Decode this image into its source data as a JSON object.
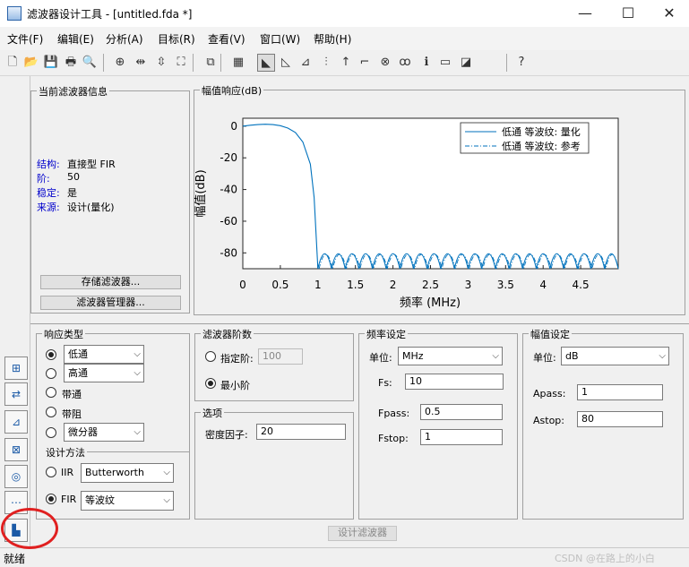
{
  "window": {
    "title": "滤波器设计工具 - [untitled.fda *]",
    "minimize": "—",
    "maximize": "☐",
    "close": "✕"
  },
  "menu": [
    "文件(F)",
    "编辑(E)",
    "分析(A)",
    "目标(R)",
    "查看(V)",
    "窗口(W)",
    "帮助(H)"
  ],
  "toolbar": {
    "icons": [
      "new-file-icon",
      "open-folder-icon",
      "save-icon",
      "print-icon",
      "print-preview-icon",
      "zoom-in-icon",
      "zoom-x-icon",
      "zoom-y-icon",
      "full-view-icon",
      "new-window-icon",
      "filter-spec-icon",
      "magnitude-response-icon",
      "phase-response-icon",
      "mag-phase-icon",
      "group-delay-icon",
      "impulse-response-icon",
      "step-response-icon",
      "pole-zero-icon",
      "coefficients-icon",
      "info-icon",
      "cost-icon",
      "noise-icon",
      "whats-this-icon"
    ],
    "glyphs": [
      "🗋",
      "📂",
      "💾",
      "🖶",
      "🔍",
      "⊕",
      "⇹",
      "⇳",
      "⛶",
      "⧉",
      "▦",
      "◣",
      "◺",
      "⊿",
      "⫶",
      "↑",
      "⌐",
      "⊗",
      "ꝏ",
      "ℹ",
      "▭",
      "◪",
      "?"
    ]
  },
  "info_panel": {
    "title": "当前滤波器信息",
    "rows": [
      {
        "key": "结构:",
        "value": "直接型 FIR"
      },
      {
        "key": "阶:",
        "value": "50"
      },
      {
        "key": "稳定:",
        "value": "是"
      },
      {
        "key": "来源:",
        "value": "设计(量化)"
      }
    ],
    "store_button": "存储滤波器...",
    "manager_button": "滤波器管理器..."
  },
  "plot_panel": {
    "title": "幅值响应(dB)"
  },
  "chart_data": {
    "type": "line",
    "xlabel": "频率 (MHz)",
    "ylabel": "幅值(dB)",
    "xlim": [
      0,
      5
    ],
    "ylim": [
      -90,
      5
    ],
    "xticks": [
      "0",
      "0.5",
      "1",
      "1.5",
      "2",
      "2.5",
      "3",
      "3.5",
      "4",
      "4.5"
    ],
    "yticks": [
      "0",
      "-20",
      "-40",
      "-60",
      "-80"
    ],
    "series": [
      {
        "name": "低通 等波纹: 量化",
        "style": "solid",
        "color": "#0072bd",
        "passband": [
          [
            0,
            0
          ],
          [
            0.1,
            0.6
          ],
          [
            0.2,
            1.0
          ],
          [
            0.3,
            1.2
          ],
          [
            0.4,
            1.0
          ],
          [
            0.5,
            0.3
          ],
          [
            0.6,
            -1.2
          ],
          [
            0.7,
            -4
          ],
          [
            0.8,
            -10
          ],
          [
            0.9,
            -24
          ],
          [
            0.95,
            -45
          ],
          [
            1.0,
            -90
          ]
        ],
        "stopband_peak_db": -75,
        "stopband_lobes": 22
      },
      {
        "name": "低通 等波纹: 参考",
        "style": "dashdot",
        "color": "#0072bd"
      }
    ]
  },
  "response_type": {
    "title": "响应类型",
    "options": [
      {
        "label": "低通",
        "dropdown": "低通",
        "selected": true
      },
      {
        "label": "高通",
        "dropdown": "高通",
        "selected": false
      },
      {
        "label": "带通",
        "selected": false
      },
      {
        "label": "带阻",
        "selected": false
      },
      {
        "label": "",
        "dropdown": "微分器",
        "selected": false
      }
    ]
  },
  "design_method": {
    "title": "设计方法",
    "iir_label": "IIR",
    "iir_value": "Butterworth",
    "fir_label": "FIR",
    "fir_value": "等波纹"
  },
  "filter_order": {
    "title": "滤波器阶数",
    "specify_label": "指定阶:",
    "specify_value": "100",
    "minimum_label": "最小阶"
  },
  "options": {
    "title": "选项",
    "density_label": "密度因子:",
    "density_value": "20"
  },
  "freq_spec": {
    "title": "频率设定",
    "unit_label": "单位:",
    "unit_value": "MHz",
    "fs_label": "Fs:",
    "fs_value": "10",
    "fpass_label": "Fpass:",
    "fpass_value": "0.5",
    "fstop_label": "Fstop:",
    "fstop_value": "1"
  },
  "mag_spec": {
    "title": "幅值设定",
    "unit_label": "单位:",
    "unit_value": "dB",
    "apass_label": "Apass:",
    "apass_value": "1",
    "astop_label": "Astop:",
    "astop_value": "80"
  },
  "design_button": "设计滤波器",
  "status": {
    "text": "就绪",
    "watermark": "CSDN @在路上的小白"
  },
  "sidebar_glyphs": [
    "⊞",
    "⇄",
    "⊿",
    "⊠",
    "◎",
    "⋯",
    "▙"
  ]
}
